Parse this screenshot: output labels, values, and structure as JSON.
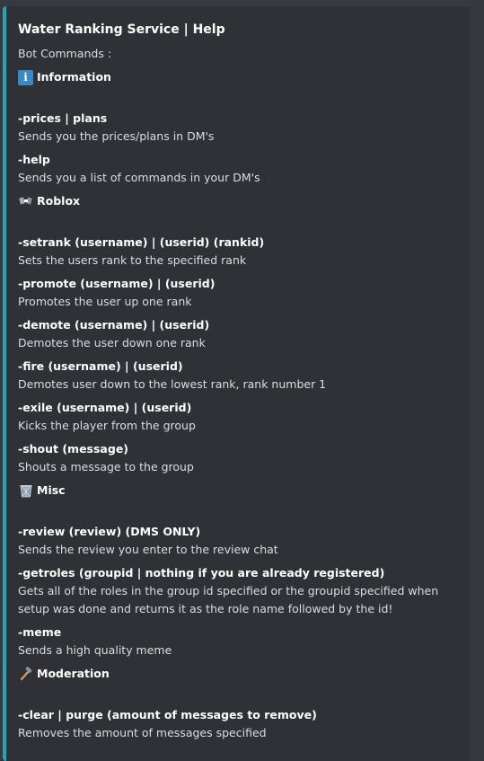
{
  "embed": {
    "title": "Water Ranking Service | Help",
    "accent_color": "#23a6b5",
    "subtitle": "Bot Commands :",
    "sections": [
      {
        "icon": "information-icon",
        "heading": "Information",
        "commands": [
          {
            "name": "-prices | plans",
            "desc": "Sends you the prices/plans in DM's"
          },
          {
            "name": "-help",
            "desc": "Sends you a list of commands in your DM's"
          }
        ]
      },
      {
        "icon": "roblox-icon",
        "heading": "Roblox",
        "commands": [
          {
            "name": "-setrank (username) | (userid) (rankid)",
            "desc": "Sets the users rank to the specified rank"
          },
          {
            "name": "-promote (username) | (userid)",
            "desc": "Promotes the user up one rank"
          },
          {
            "name": "-demote (username) | (userid)",
            "desc": "Demotes the user down one rank"
          },
          {
            "name": "-fire (username) | (userid)",
            "desc": "Demotes user down to the lowest rank, rank number 1"
          },
          {
            "name": "-exile (username) | (userid)",
            "desc": "Kicks the player from the group"
          },
          {
            "name": "-shout (message)",
            "desc": "Shouts a message to the group"
          }
        ]
      },
      {
        "icon": "wastebasket-icon",
        "heading": "Misc",
        "commands": [
          {
            "name": "-review (review) (DMS ONLY)",
            "desc": "Sends the review you enter to the review chat"
          },
          {
            "name": "-getroles (groupid | nothing if you are already registered)",
            "desc": "Gets all of the roles in the group id specified or the groupid specified when setup was done and returns it as the role name followed by the id!"
          },
          {
            "name": "-meme",
            "desc": "Sends a high quality meme"
          }
        ]
      },
      {
        "icon": "hammer-icon",
        "heading": "Moderation",
        "commands": [
          {
            "name": "-clear | purge (amount of messages to remove)",
            "desc": "Removes the amount of messages specified"
          }
        ]
      }
    ]
  }
}
